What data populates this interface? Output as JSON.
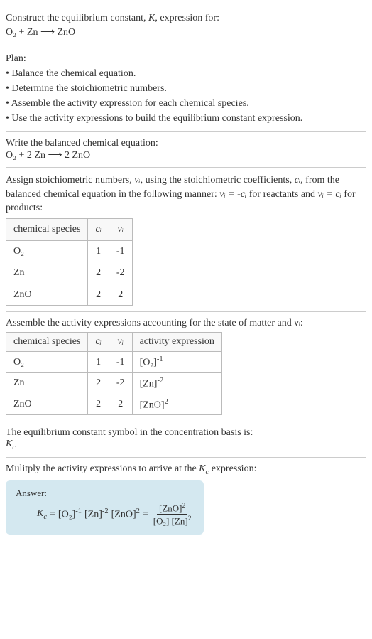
{
  "intro": {
    "line1": "Construct the equilibrium constant, ",
    "K": "K",
    "line1b": ", expression for:",
    "equation": "O₂ + Zn ⟶ ZnO"
  },
  "plan": {
    "title": "Plan:",
    "items": [
      "• Balance the chemical equation.",
      "• Determine the stoichiometric numbers.",
      "• Assemble the activity expression for each chemical species.",
      "• Use the activity expressions to build the equilibrium constant expression."
    ]
  },
  "balanced": {
    "title": "Write the balanced chemical equation:",
    "equation": "O₂ + 2 Zn ⟶ 2 ZnO"
  },
  "stoich": {
    "text1": "Assign stoichiometric numbers, ",
    "nu": "νᵢ",
    "text2": ", using the stoichiometric coefficients, ",
    "ci": "cᵢ",
    "text3": ", from the balanced chemical equation in the following manner: ",
    "rel1": "νᵢ = -cᵢ",
    "text4": " for reactants and ",
    "rel2": "νᵢ = cᵢ",
    "text5": " for products:",
    "headers": [
      "chemical species",
      "cᵢ",
      "νᵢ"
    ],
    "rows": [
      {
        "species": "O₂",
        "c": "1",
        "nu": "-1"
      },
      {
        "species": "Zn",
        "c": "2",
        "nu": "-2"
      },
      {
        "species": "ZnO",
        "c": "2",
        "nu": "2"
      }
    ]
  },
  "activity": {
    "title": "Assemble the activity expressions accounting for the state of matter and νᵢ:",
    "headers": [
      "chemical species",
      "cᵢ",
      "νᵢ",
      "activity expression"
    ],
    "rows": [
      {
        "species": "O₂",
        "c": "1",
        "nu": "-1",
        "expr_base": "[O₂]",
        "expr_exp": "-1"
      },
      {
        "species": "Zn",
        "c": "2",
        "nu": "-2",
        "expr_base": "[Zn]",
        "expr_exp": "-2"
      },
      {
        "species": "ZnO",
        "c": "2",
        "nu": "2",
        "expr_base": "[ZnO]",
        "expr_exp": "2"
      }
    ]
  },
  "symbol": {
    "text": "The equilibrium constant symbol in the concentration basis is:",
    "kc": "K",
    "kc_sub": "c"
  },
  "multiply": {
    "text1": "Mulitply the activity expressions to arrive at the ",
    "kc": "K",
    "kc_sub": "c",
    "text2": " expression:"
  },
  "answer": {
    "label": "Answer:",
    "kc": "K",
    "kc_sub": "c",
    "eq": " = ",
    "t1_base": "[O₂]",
    "t1_exp": "-1",
    "t2_base": "[Zn]",
    "t2_exp": "-2",
    "t3_base": "[ZnO]",
    "t3_exp": "2",
    "eq2": " = ",
    "num_base": "[ZnO]",
    "num_exp": "2",
    "den1_base": "[O₂]",
    "den2_base": "[Zn]",
    "den2_exp": "2"
  }
}
